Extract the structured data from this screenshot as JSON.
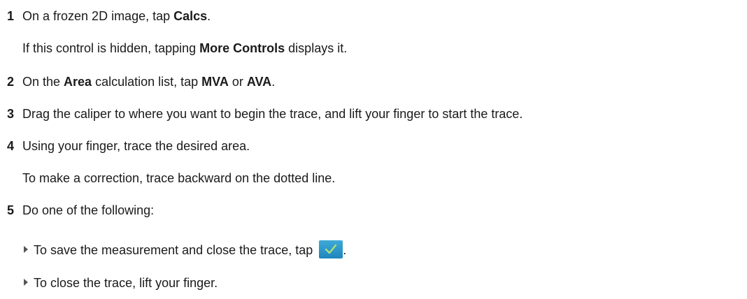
{
  "steps": [
    {
      "num": "1",
      "pre": "On a frozen 2D image, tap ",
      "b1": "Calcs",
      "post": "."
    },
    {
      "note_pre": "If this control is hidden, tapping ",
      "note_b": "More Controls",
      "note_post": " displays it."
    },
    {
      "num": "2",
      "pre": "On the ",
      "b1": "Area",
      "mid1": " calculation list, tap ",
      "b2": "MVA",
      "mid2": " or ",
      "b3": "AVA",
      "post": "."
    },
    {
      "num": "3",
      "text": "Drag the caliper to where you want to begin the trace, and lift your finger to start the trace."
    },
    {
      "num": "4",
      "text": "Using your finger, trace the desired area."
    },
    {
      "note": "To make a correction, trace backward on the dotted line."
    },
    {
      "num": "5",
      "text": "Do one of the following:"
    }
  ],
  "bullets": [
    {
      "pre": "To save the measurement and close the trace, tap ",
      "icon": "checkmark-icon",
      "post": "."
    },
    {
      "text": "To close the trace, lift your finger."
    }
  ],
  "colors": {
    "button": "#2a97cc",
    "check": "#a8e07a"
  }
}
